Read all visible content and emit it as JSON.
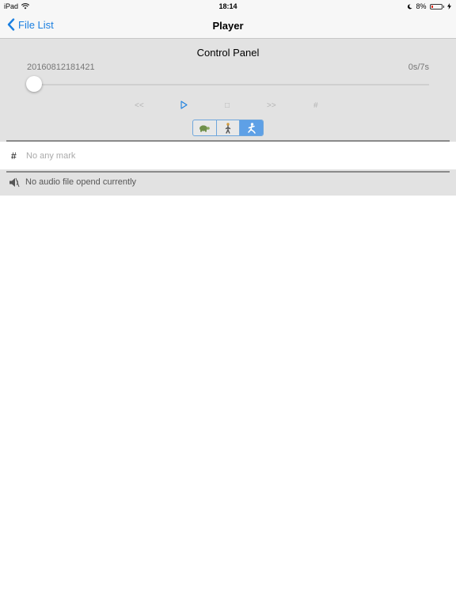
{
  "status": {
    "device": "iPad",
    "time": "18:14",
    "battery": "8%"
  },
  "nav": {
    "back_label": "File List",
    "title": "Player"
  },
  "control_panel": {
    "title": "Control Panel",
    "file_name": "20160812181421",
    "time": "0s/7s",
    "progress": 0,
    "controls": {
      "rewind": "<<",
      "stop": "□",
      "forward": ">>",
      "mark": "#"
    },
    "speed_options": [
      "turtle-icon",
      "walker-icon",
      "runner-icon"
    ],
    "speed_selected": 2
  },
  "marks": {
    "hash": "#",
    "empty_text": "No any mark"
  },
  "audio": {
    "status_text": "No audio file opend currently"
  },
  "colors": {
    "accent": "#1a7fe0",
    "panel_bg": "#e2e2e2",
    "segment_selected": "#5ea0e6"
  }
}
